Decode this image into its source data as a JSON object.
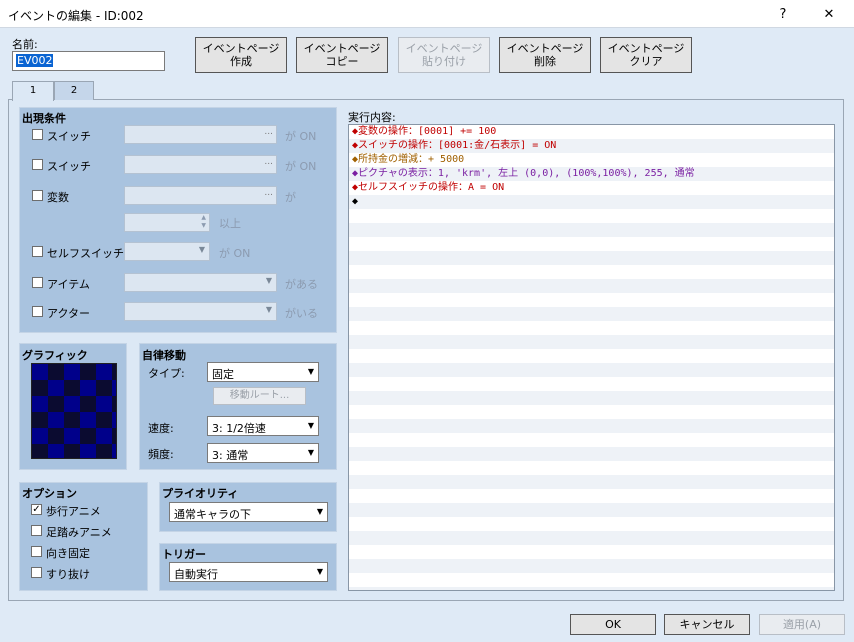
{
  "window": {
    "title": "イベントの編集 - ID:002",
    "help": "?",
    "close": "✕"
  },
  "name": {
    "label": "名前:",
    "value": "EV002"
  },
  "page_buttons": [
    {
      "line1": "イベントページ",
      "line2": "作成"
    },
    {
      "line1": "イベントページ",
      "line2": "コピー"
    },
    {
      "line1": "イベントページ",
      "line2": "貼り付け"
    },
    {
      "line1": "イベントページ",
      "line2": "削除"
    },
    {
      "line1": "イベントページ",
      "line2": "クリア"
    }
  ],
  "tabs": [
    "1",
    "2"
  ],
  "conditions": {
    "title": "出現条件",
    "switch1": {
      "label": "スイッチ",
      "suffix": "が ON"
    },
    "switch2": {
      "label": "スイッチ",
      "suffix": "が ON"
    },
    "variable": {
      "label": "変数",
      "suffix": "が",
      "above": "以上"
    },
    "self_switch": {
      "label": "セルフスイッチ",
      "suffix": "が ON"
    },
    "item": {
      "label": "アイテム",
      "suffix": "がある"
    },
    "actor": {
      "label": "アクター",
      "suffix": "がいる"
    }
  },
  "graphic": {
    "title": "グラフィック"
  },
  "autonomous": {
    "title": "自律移動",
    "type_label": "タイプ:",
    "type_value": "固定",
    "route_button": "移動ルート...",
    "speed_label": "速度:",
    "speed_value": "3: 1/2倍速",
    "freq_label": "頻度:",
    "freq_value": "3: 通常"
  },
  "options": {
    "title": "オプション",
    "items": [
      {
        "label": "歩行アニメ",
        "checked": true
      },
      {
        "label": "足踏みアニメ",
        "checked": false
      },
      {
        "label": "向き固定",
        "checked": false
      },
      {
        "label": "すり抜け",
        "checked": false
      }
    ]
  },
  "priority": {
    "title": "プライオリティ",
    "value": "通常キャラの下"
  },
  "trigger": {
    "title": "トリガー",
    "value": "自動実行"
  },
  "contents": {
    "label": "実行内容:",
    "commands": [
      {
        "text": "◆変数の操作：[0001] += 100",
        "color": "#c00000"
      },
      {
        "text": "◆スイッチの操作：[0001:金/石表示] = ON",
        "color": "#c00000"
      },
      {
        "text": "◆所持金の増減：+ 5000",
        "color": "#a06000"
      },
      {
        "text": "◆ピクチャの表示：1, 'krm', 左上 (0,0), (100%,100%), 255, 通常",
        "color": "#7a1fa2"
      },
      {
        "text": "◆セルフスイッチの操作：A = ON",
        "color": "#c00000"
      },
      {
        "text": "◆",
        "color": "#000000"
      }
    ]
  },
  "footer": {
    "ok": "OK",
    "cancel": "キャンセル",
    "apply": "適用(A)"
  },
  "icons": {
    "dropdown": "▼",
    "ellipsis": "...",
    "check": "✓",
    "spin_up": "▲",
    "spin_down": "▼"
  }
}
